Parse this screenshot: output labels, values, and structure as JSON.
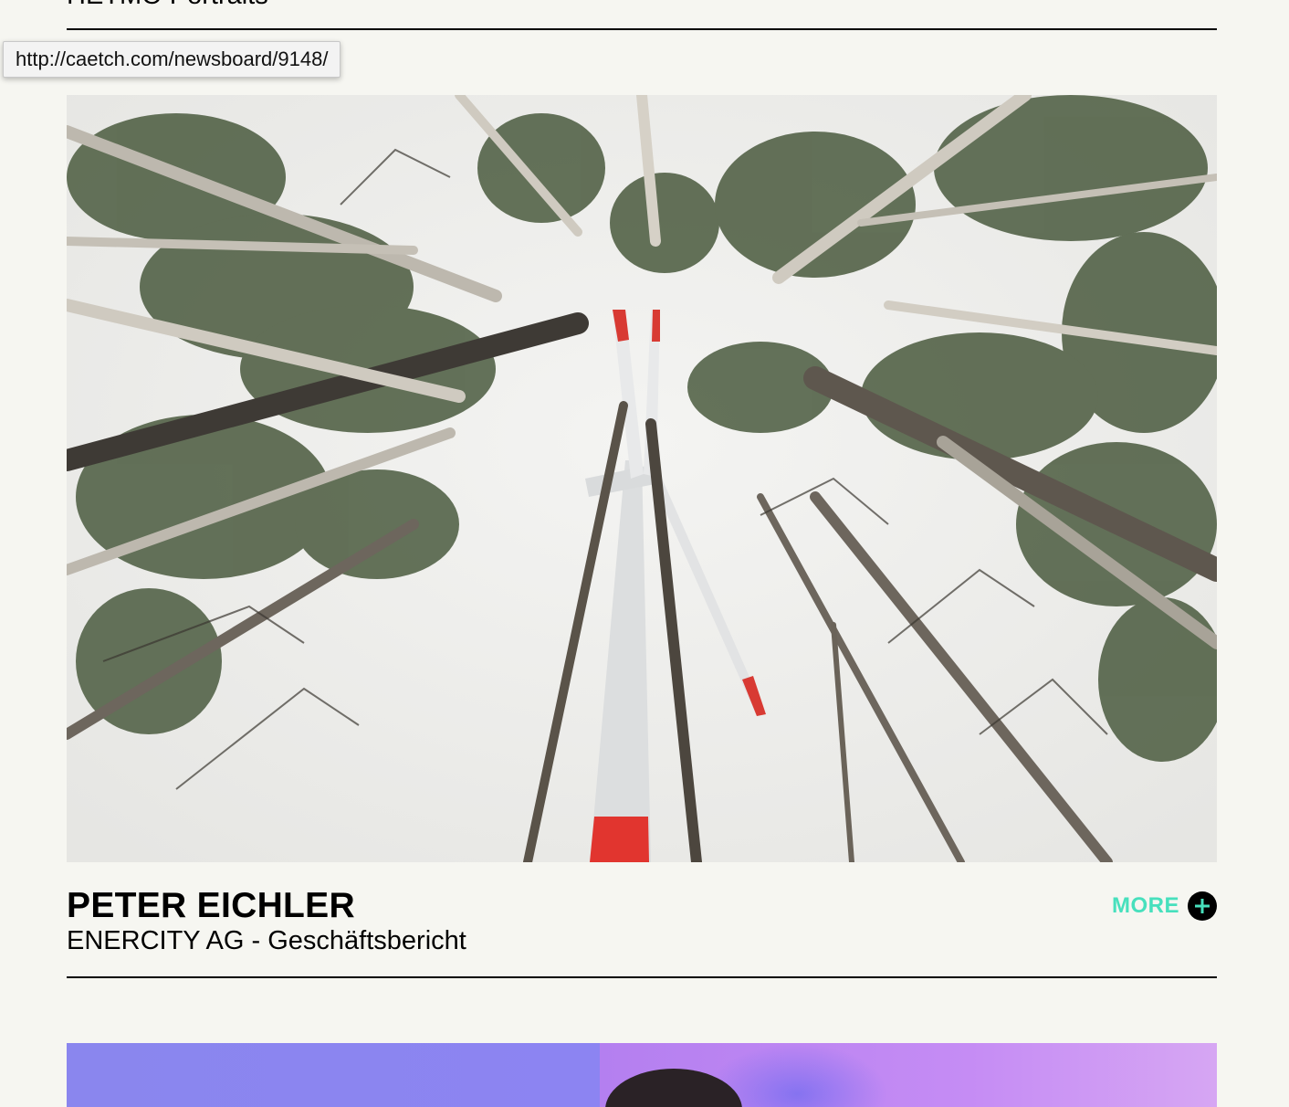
{
  "previous_entry": {
    "title": "HETMO Portraits"
  },
  "status_tooltip": {
    "url": "http://caetch.com/newsboard/9148/"
  },
  "entry": {
    "name": "PETER EICHLER",
    "subtitle": "ENERCITY AG - Geschäftsbericht",
    "more_label": "MORE",
    "photo_icon": "wind-turbine-forest-photo"
  },
  "colors": {
    "background": "#f6f6f1",
    "accent": "#47e0bd",
    "text": "#000000"
  }
}
